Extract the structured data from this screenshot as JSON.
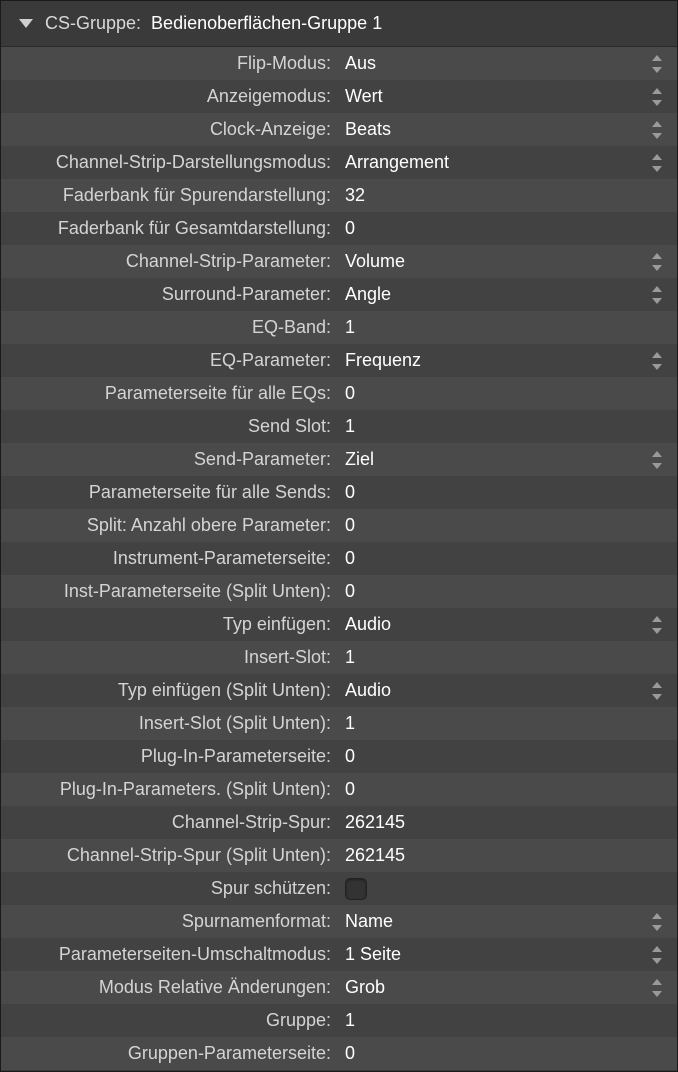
{
  "header": {
    "label": "CS-Gruppe:",
    "value": "Bedienoberflächen-Gruppe 1"
  },
  "rows": [
    {
      "label": "Flip-Modus:",
      "value": "Aus",
      "type": "dropdown"
    },
    {
      "label": "Anzeigemodus:",
      "value": "Wert",
      "type": "dropdown"
    },
    {
      "label": "Clock-Anzeige:",
      "value": "Beats",
      "type": "dropdown"
    },
    {
      "label": "Channel-Strip-Darstellungsmodus:",
      "value": "Arrangement",
      "type": "dropdown"
    },
    {
      "label": "Faderbank für Spurendarstellung:",
      "value": "32",
      "type": "number"
    },
    {
      "label": "Faderbank für Gesamtdarstellung:",
      "value": "0",
      "type": "number"
    },
    {
      "label": "Channel-Strip-Parameter:",
      "value": "Volume",
      "type": "dropdown"
    },
    {
      "label": "Surround-Parameter:",
      "value": "Angle",
      "type": "dropdown"
    },
    {
      "label": "EQ-Band:",
      "value": "1",
      "type": "number"
    },
    {
      "label": "EQ-Parameter:",
      "value": "Frequenz",
      "type": "dropdown"
    },
    {
      "label": "Parameterseite für alle EQs:",
      "value": "0",
      "type": "number"
    },
    {
      "label": "Send Slot:",
      "value": "1",
      "type": "number"
    },
    {
      "label": "Send-Parameter:",
      "value": "Ziel",
      "type": "dropdown"
    },
    {
      "label": "Parameterseite für alle Sends:",
      "value": "0",
      "type": "number"
    },
    {
      "label": "Split: Anzahl obere Parameter:",
      "value": "0",
      "type": "number"
    },
    {
      "label": "Instrument-Parameterseite:",
      "value": "0",
      "type": "number"
    },
    {
      "label": "Inst-Parameterseite (Split Unten):",
      "value": "0",
      "type": "number"
    },
    {
      "label": "Typ einfügen:",
      "value": "Audio",
      "type": "dropdown"
    },
    {
      "label": "Insert-Slot:",
      "value": "1",
      "type": "number"
    },
    {
      "label": "Typ einfügen (Split Unten):",
      "value": "Audio",
      "type": "dropdown"
    },
    {
      "label": "Insert-Slot (Split Unten):",
      "value": "1",
      "type": "number"
    },
    {
      "label": "Plug-In-Parameterseite:",
      "value": "0",
      "type": "number"
    },
    {
      "label": "Plug-In-Parameters. (Split Unten):",
      "value": "0",
      "type": "number"
    },
    {
      "label": "Channel-Strip-Spur:",
      "value": "262145",
      "type": "number"
    },
    {
      "label": "Channel-Strip-Spur (Split Unten):",
      "value": "262145",
      "type": "number"
    },
    {
      "label": "Spur schützen:",
      "value": "",
      "type": "checkbox"
    },
    {
      "label": "Spurnamenformat:",
      "value": "Name",
      "type": "dropdown"
    },
    {
      "label": "Parameterseiten-Umschaltmodus:",
      "value": "1 Seite",
      "type": "dropdown"
    },
    {
      "label": "Modus Relative Änderungen:",
      "value": "Grob",
      "type": "dropdown"
    },
    {
      "label": "Gruppe:",
      "value": "1",
      "type": "number"
    },
    {
      "label": "Gruppen-Parameterseite:",
      "value": "0",
      "type": "number"
    }
  ]
}
